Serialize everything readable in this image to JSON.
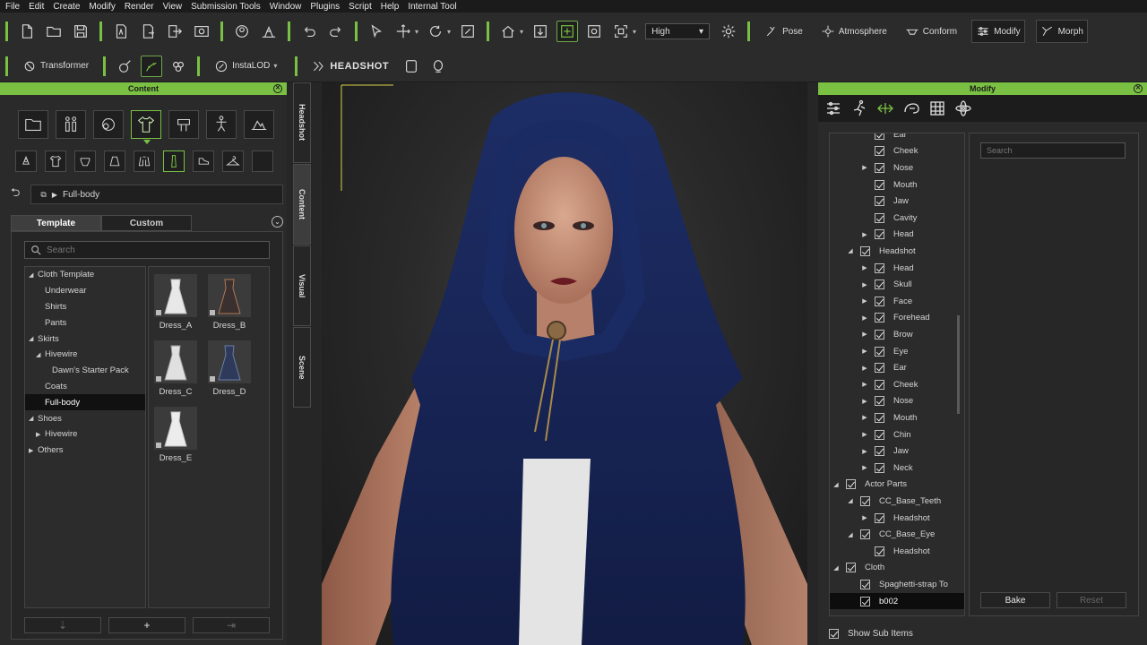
{
  "menu": [
    "File",
    "Edit",
    "Create",
    "Modify",
    "Render",
    "View",
    "Submission Tools",
    "Window",
    "Plugins",
    "Script",
    "Help",
    "Internal Tool"
  ],
  "toolbar1": {
    "quality_value": "High",
    "pose_label": "Pose",
    "atmosphere_label": "Atmosphere",
    "conform_label": "Conform",
    "modify_label": "Modify",
    "morph_label": "Morph"
  },
  "toolbar2": {
    "transformer_label": "Transformer",
    "instalod_label": "InstaLOD",
    "headshot_label": "HEADSHOT"
  },
  "content_panel": {
    "title": "Content",
    "breadcrumb": "Full-body",
    "tabs": [
      "Template",
      "Custom"
    ],
    "search_placeholder": "Search",
    "tree": [
      {
        "label": "Cloth Template",
        "level": 0,
        "expanded": true
      },
      {
        "label": "Underwear",
        "level": 1
      },
      {
        "label": "Shirts",
        "level": 1
      },
      {
        "label": "Pants",
        "level": 1
      },
      {
        "label": "Skirts",
        "level": 0,
        "expanded": true
      },
      {
        "label": "Hivewire",
        "level": 1,
        "expanded": true
      },
      {
        "label": "Dawn's Starter Pack",
        "level": 2
      },
      {
        "label": "Coats",
        "level": 1
      },
      {
        "label": "Full-body",
        "level": 1,
        "selected": true
      },
      {
        "label": "Shoes",
        "level": 0,
        "expanded": true
      },
      {
        "label": "Hivewire",
        "level": 1,
        "collapsed": true
      },
      {
        "label": "Others",
        "level": 0,
        "collapsed": true
      }
    ],
    "items": [
      "Dress_A",
      "Dress_B",
      "Dress_C",
      "Dress_D",
      "Dress_E"
    ],
    "add_button": "+"
  },
  "side_tabs": [
    "Headshot",
    "Content",
    "Visual",
    "Scene"
  ],
  "modify_panel": {
    "title": "Modify",
    "search_placeholder": "Search",
    "bake_label": "Bake",
    "reset_label": "Reset",
    "show_sub_items_label": "Show Sub Items",
    "tree": [
      {
        "label": "Ear",
        "indent": 3,
        "arrow": "none"
      },
      {
        "label": "Cheek",
        "indent": 3,
        "arrow": "none"
      },
      {
        "label": "Nose",
        "indent": 3,
        "arrow": "right"
      },
      {
        "label": "Mouth",
        "indent": 3,
        "arrow": "none"
      },
      {
        "label": "Jaw",
        "indent": 3,
        "arrow": "none"
      },
      {
        "label": "Cavity",
        "indent": 3,
        "arrow": "none"
      },
      {
        "label": "Head",
        "indent": 3,
        "arrow": "right"
      },
      {
        "label": "Headshot",
        "indent": 2,
        "arrow": "down"
      },
      {
        "label": "Head",
        "indent": 3,
        "arrow": "right"
      },
      {
        "label": "Skull",
        "indent": 3,
        "arrow": "right"
      },
      {
        "label": "Face",
        "indent": 3,
        "arrow": "right"
      },
      {
        "label": "Forehead",
        "indent": 3,
        "arrow": "right"
      },
      {
        "label": "Brow",
        "indent": 3,
        "arrow": "right"
      },
      {
        "label": "Eye",
        "indent": 3,
        "arrow": "right"
      },
      {
        "label": "Ear",
        "indent": 3,
        "arrow": "right"
      },
      {
        "label": "Cheek",
        "indent": 3,
        "arrow": "right"
      },
      {
        "label": "Nose",
        "indent": 3,
        "arrow": "right"
      },
      {
        "label": "Mouth",
        "indent": 3,
        "arrow": "right"
      },
      {
        "label": "Chin",
        "indent": 3,
        "arrow": "right"
      },
      {
        "label": "Jaw",
        "indent": 3,
        "arrow": "right"
      },
      {
        "label": "Neck",
        "indent": 3,
        "arrow": "right"
      },
      {
        "label": "Actor Parts",
        "indent": 1,
        "arrow": "down"
      },
      {
        "label": "CC_Base_Teeth",
        "indent": 2,
        "arrow": "down"
      },
      {
        "label": "Headshot",
        "indent": 3,
        "arrow": "right"
      },
      {
        "label": "CC_Base_Eye",
        "indent": 2,
        "arrow": "down"
      },
      {
        "label": "Headshot",
        "indent": 3,
        "arrow": "none"
      },
      {
        "label": "Cloth",
        "indent": 1,
        "arrow": "down"
      },
      {
        "label": "Spaghetti-strap To",
        "indent": 2,
        "arrow": "none"
      },
      {
        "label": "b002",
        "indent": 2,
        "arrow": "none",
        "selected": true
      }
    ]
  },
  "colors": {
    "accent": "#7ac143",
    "panel_bg": "#2a2a2a",
    "cloak": "#14224f"
  }
}
